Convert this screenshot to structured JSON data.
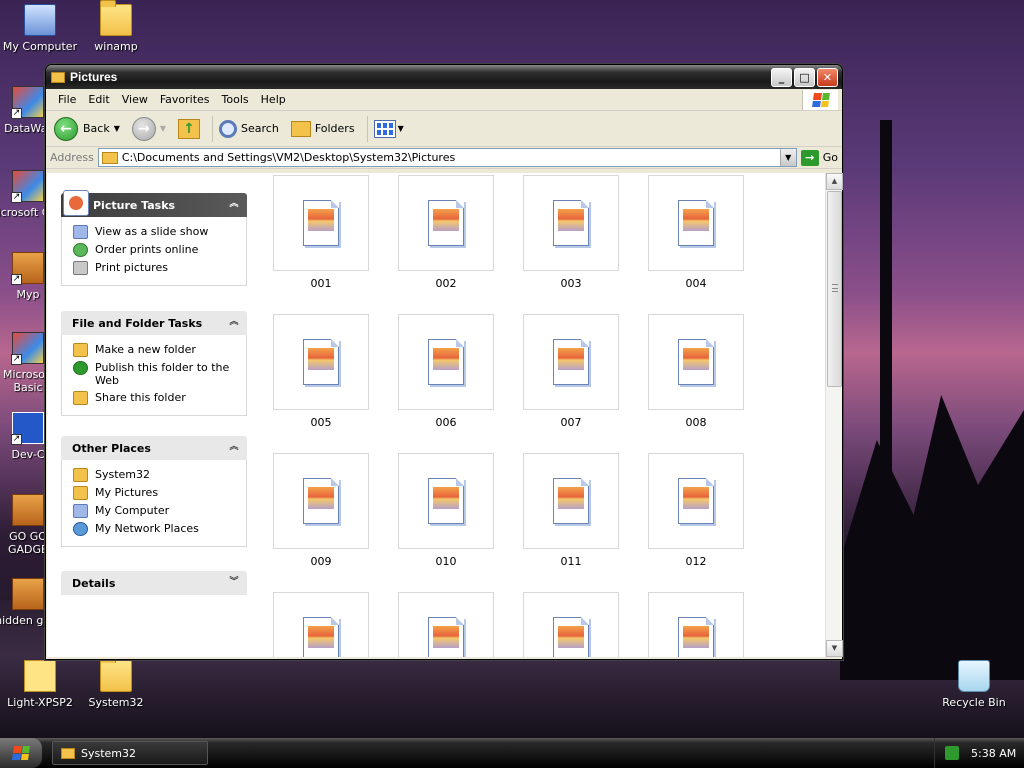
{
  "desktop": {
    "icons": {
      "my_computer": "My Computer",
      "winamp": "winamp",
      "datawar": "DataWar",
      "msvcpp": "Microsoft C++",
      "myp": "Myp",
      "msbasic": "Microsoft Basic",
      "devc": "Dev-C",
      "gogo": "GO GO GADGE",
      "hidden": "hidden gam",
      "lightxp": "Light-XPSP2",
      "system32": "System32",
      "recycle": "Recycle Bin"
    }
  },
  "window": {
    "title": "Pictures",
    "menu": [
      "File",
      "Edit",
      "View",
      "Favorites",
      "Tools",
      "Help"
    ],
    "toolbar": {
      "back": "Back",
      "search": "Search",
      "folders": "Folders"
    },
    "address": {
      "label": "Address",
      "value": "C:\\Documents and Settings\\VM2\\Desktop\\System32\\Pictures",
      "go": "Go"
    },
    "taskpane": {
      "picture_tasks": {
        "title": "Picture Tasks",
        "items": [
          "View as a slide show",
          "Order prints online",
          "Print pictures"
        ]
      },
      "file_folder_tasks": {
        "title": "File and Folder Tasks",
        "items": [
          "Make a new folder",
          "Publish this folder to the Web",
          "Share this folder"
        ]
      },
      "other_places": {
        "title": "Other Places",
        "items": [
          "System32",
          "My Pictures",
          "My Computer",
          "My Network Places"
        ]
      },
      "details": {
        "title": "Details"
      }
    },
    "files": [
      "001",
      "002",
      "003",
      "004",
      "005",
      "006",
      "007",
      "008",
      "009",
      "010",
      "011",
      "012"
    ]
  },
  "taskbar": {
    "task": "System32",
    "clock": "5:38 AM"
  },
  "colors": {
    "folder": "#f2c24a",
    "go_green": "#2e9a2e",
    "task_header_dark": "#3c3c3c"
  }
}
